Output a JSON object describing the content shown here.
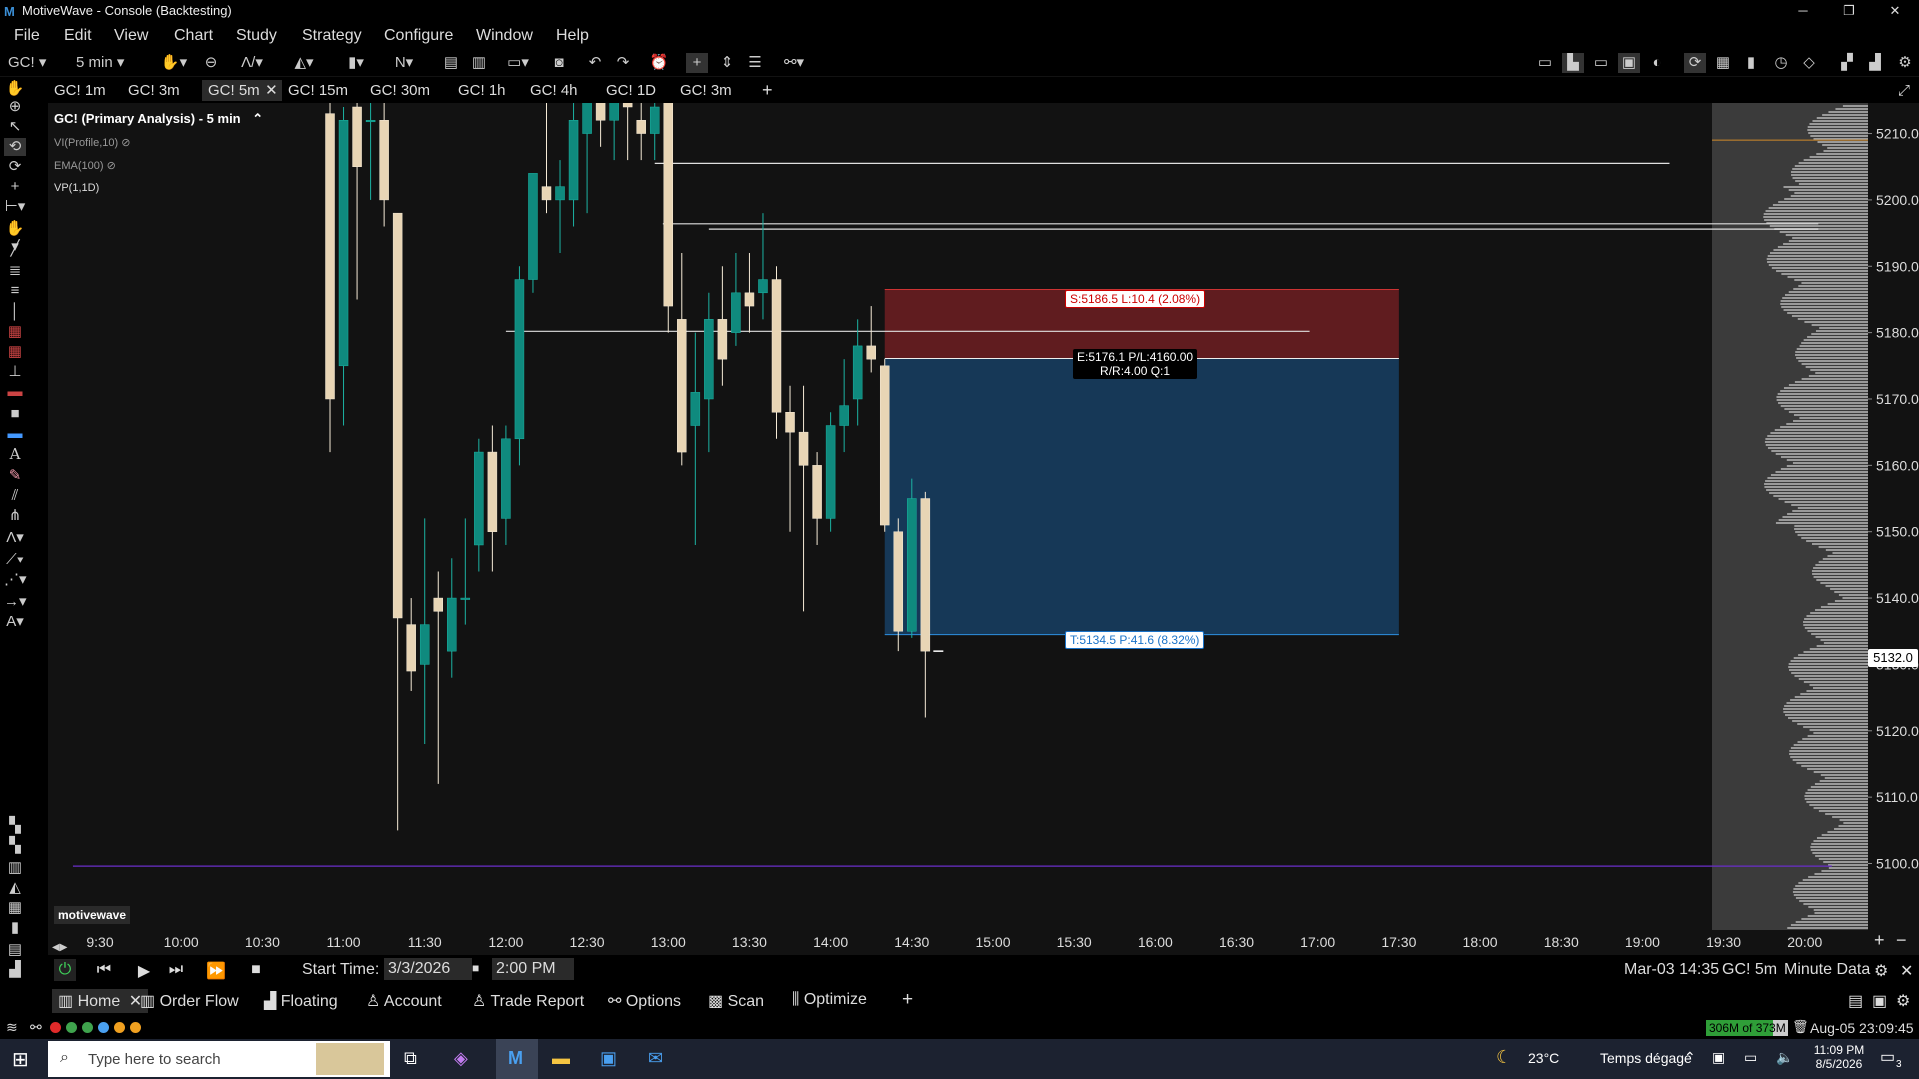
{
  "window": {
    "title": "MotiveWave - Console (Backtesting)",
    "logo": "M",
    "controls": [
      "─",
      "❐",
      "✕"
    ]
  },
  "menu": [
    "File",
    "Edit",
    "View",
    "Chart",
    "Study",
    "Strategy",
    "Configure",
    "Window",
    "Help"
  ],
  "toolbar": {
    "symbol": "GC!",
    "timeframe": "5 min"
  },
  "tabs": [
    "GC! 1m",
    "GC! 3m",
    "GC! 5m",
    "GC! 15m",
    "GC! 30m",
    "GC! 1h",
    "GC! 4h",
    "GC! 1D",
    "GC! 3m"
  ],
  "active_tab_index": 2,
  "chart": {
    "title": "GC! (Primary Analysis) - 5 min",
    "studies": [
      "VI(Profile,10)",
      "EMA(100)",
      "VP(1,1D)"
    ],
    "watermark": "motivewave",
    "stop_label": "S:5186.5 L:10.4 (2.08%)",
    "entry_label_1": "E:5176.1 P/L:4160.00",
    "entry_label_2": "R/R:4.00 Q:1",
    "target_label": "T:5134.5 P:41.6 (8.32%)",
    "current_price": "5132.0"
  },
  "chart_data": {
    "type": "candlestick",
    "instrument": "GC! 5 min",
    "y_ticks": [
      5100,
      5110,
      5120,
      5130,
      5140,
      5150,
      5160,
      5170,
      5180,
      5190,
      5200,
      5210
    ],
    "y_tick_labels": [
      "5100.0",
      "5110.0",
      "5120.0",
      "5130.0",
      "5140.0",
      "5150.0",
      "5160.0",
      "5170.0",
      "5180.0",
      "5190.0",
      "5200.0",
      "5210.0"
    ],
    "x_tick_labels": [
      "9:30",
      "10:00",
      "10:30",
      "11:00",
      "11:30",
      "12:00",
      "12:30",
      "13:00",
      "13:30",
      "14:00",
      "14:30",
      "15:00",
      "15:30",
      "16:00",
      "16:30",
      "17:00",
      "17:30",
      "18:00",
      "18:30",
      "19:00",
      "19:30",
      "20:00"
    ],
    "x_tick_minutes": [
      570,
      600,
      630,
      660,
      690,
      720,
      750,
      780,
      810,
      840,
      870,
      900,
      930,
      960,
      990,
      1020,
      1050,
      1080,
      1110,
      1140,
      1170,
      1200
    ],
    "ylim": [
      5090,
      5214
    ],
    "candles": [
      {
        "t": 655,
        "o": 5213,
        "h": 5216,
        "l": 5162,
        "c": 5170
      },
      {
        "t": 660,
        "o": 5175,
        "h": 5214,
        "l": 5166,
        "c": 5212
      },
      {
        "t": 665,
        "o": 5214,
        "h": 5216,
        "l": 5185,
        "c": 5205
      },
      {
        "t": 670,
        "o": 5212,
        "h": 5216,
        "l": 5200,
        "c": 5212
      },
      {
        "t": 675,
        "o": 5212,
        "h": 5216,
        "l": 5196,
        "c": 5200
      },
      {
        "t": 680,
        "o": 5198,
        "h": 5198,
        "l": 5105,
        "c": 5137
      },
      {
        "t": 685,
        "o": 5136,
        "h": 5140,
        "l": 5126,
        "c": 5129
      },
      {
        "t": 690,
        "o": 5130,
        "h": 5152,
        "l": 5118,
        "c": 5136
      },
      {
        "t": 695,
        "o": 5140,
        "h": 5144,
        "l": 5112,
        "c": 5138
      },
      {
        "t": 700,
        "o": 5132,
        "h": 5146,
        "l": 5128,
        "c": 5140
      },
      {
        "t": 705,
        "o": 5140,
        "h": 5152,
        "l": 5136,
        "c": 5140
      },
      {
        "t": 710,
        "o": 5148,
        "h": 5164,
        "l": 5144,
        "c": 5162
      },
      {
        "t": 715,
        "o": 5162,
        "h": 5166,
        "l": 5144,
        "c": 5150
      },
      {
        "t": 720,
        "o": 5152,
        "h": 5166,
        "l": 5148,
        "c": 5164
      },
      {
        "t": 725,
        "o": 5164,
        "h": 5190,
        "l": 5160,
        "c": 5188
      },
      {
        "t": 730,
        "o": 5188,
        "h": 5204,
        "l": 5186,
        "c": 5204
      },
      {
        "t": 735,
        "o": 5202,
        "h": 5216,
        "l": 5198,
        "c": 5200
      },
      {
        "t": 740,
        "o": 5200,
        "h": 5206,
        "l": 5192,
        "c": 5202
      },
      {
        "t": 745,
        "o": 5200,
        "h": 5216,
        "l": 5196,
        "c": 5212
      },
      {
        "t": 750,
        "o": 5210,
        "h": 5216,
        "l": 5198,
        "c": 5216
      },
      {
        "t": 755,
        "o": 5216,
        "h": 5216,
        "l": 5208,
        "c": 5212
      },
      {
        "t": 760,
        "o": 5212,
        "h": 5216,
        "l": 5206,
        "c": 5216
      },
      {
        "t": 765,
        "o": 5216,
        "h": 5216,
        "l": 5206,
        "c": 5214
      },
      {
        "t": 770,
        "o": 5212,
        "h": 5216,
        "l": 5206,
        "c": 5210
      },
      {
        "t": 775,
        "o": 5210,
        "h": 5216,
        "l": 5206,
        "c": 5214
      },
      {
        "t": 780,
        "o": 5216,
        "h": 5216,
        "l": 5180,
        "c": 5184
      },
      {
        "t": 785,
        "o": 5182,
        "h": 5192,
        "l": 5160,
        "c": 5162
      },
      {
        "t": 790,
        "o": 5166,
        "h": 5180,
        "l": 5148,
        "c": 5171
      },
      {
        "t": 795,
        "o": 5170,
        "h": 5186,
        "l": 5162,
        "c": 5182
      },
      {
        "t": 800,
        "o": 5182,
        "h": 5190,
        "l": 5172,
        "c": 5176
      },
      {
        "t": 805,
        "o": 5180,
        "h": 5192,
        "l": 5178,
        "c": 5186
      },
      {
        "t": 810,
        "o": 5186,
        "h": 5192,
        "l": 5180,
        "c": 5184
      },
      {
        "t": 815,
        "o": 5186,
        "h": 5198,
        "l": 5182,
        "c": 5188
      },
      {
        "t": 820,
        "o": 5188,
        "h": 5190,
        "l": 5164,
        "c": 5168
      },
      {
        "t": 825,
        "o": 5168,
        "h": 5172,
        "l": 5150,
        "c": 5165
      },
      {
        "t": 830,
        "o": 5165,
        "h": 5172,
        "l": 5138,
        "c": 5160
      },
      {
        "t": 835,
        "o": 5160,
        "h": 5162,
        "l": 5148,
        "c": 5152
      },
      {
        "t": 840,
        "o": 5152,
        "h": 5168,
        "l": 5150,
        "c": 5166
      },
      {
        "t": 845,
        "o": 5166,
        "h": 5176,
        "l": 5162,
        "c": 5169
      },
      {
        "t": 850,
        "o": 5170,
        "h": 5182,
        "l": 5166,
        "c": 5178
      },
      {
        "t": 855,
        "o": 5178,
        "h": 5184,
        "l": 5174,
        "c": 5176
      },
      {
        "t": 860,
        "o": 5175,
        "h": 5176,
        "l": 5150,
        "c": 5151
      },
      {
        "t": 865,
        "o": 5150,
        "h": 5152,
        "l": 5132,
        "c": 5135
      },
      {
        "t": 870,
        "o": 5135,
        "h": 5158,
        "l": 5134,
        "c": 5155
      },
      {
        "t": 875,
        "o": 5155,
        "h": 5156,
        "l": 5122,
        "c": 5132
      }
    ],
    "horizontal_lines": [
      {
        "price": 5205.5,
        "t_start": 775,
        "t_end": 1150,
        "color": "#e0e0e0"
      },
      {
        "price": 5196.4,
        "t_start": 778,
        "t_end": 1205,
        "color": "#e0e0e0"
      },
      {
        "price": 5195.6,
        "t_start": 795,
        "t_end": 1205,
        "color": "#e0e0e0"
      },
      {
        "price": 5180.2,
        "t_start": 720,
        "t_end": 1017,
        "color": "#e0e0e0"
      },
      {
        "price": 5099.6,
        "t_start": 560,
        "t_end": 1210,
        "color": "#6a2ec9"
      }
    ],
    "trade": {
      "entry": 5176.1,
      "stop": 5186.5,
      "target": 5134.5,
      "t_start": 860,
      "t_end": 1050
    }
  },
  "playback": {
    "start_time_label": "Start Time:",
    "date": "3/3/2026",
    "time": "2:00 PM",
    "right_date": "Mar-03 14:35",
    "right_symbol": "GC! 5m",
    "right_data": "Minute Data"
  },
  "bottom_tabs": [
    "Home",
    "Order Flow",
    "Floating",
    "Account",
    "Trade Report",
    "Options",
    "Scan",
    "Optimize"
  ],
  "status": {
    "memory": "306M of 373M",
    "datetime": "Aug-05 23:09:45"
  },
  "taskbar": {
    "search_placeholder": "Type here to search",
    "weather_temp": "23°C",
    "weather_text": "Temps dégagé",
    "clock_time": "11:09 PM",
    "clock_date": "8/5/2026",
    "notification_count": "3"
  },
  "colors": {
    "bull": "#0f8a7e",
    "bear": "#e8d5b5",
    "stop_zone": "#6e1f22",
    "target_zone": "#173b5c",
    "accent": "#2d8fe0"
  }
}
